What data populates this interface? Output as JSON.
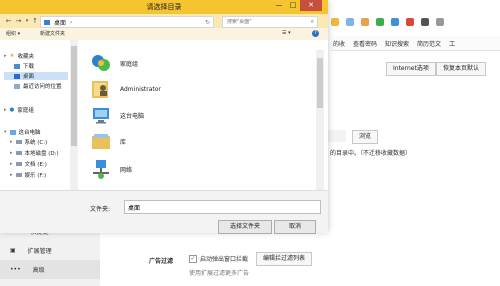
{
  "background": {
    "favorites_bar": [
      "的收",
      "查看密码",
      "知识搜索",
      "简历范文",
      "工"
    ],
    "internet_options_label": "Internet选项",
    "restore_default_label": "恢复本页默认",
    "browse_label": "浏览",
    "description": "的目录中。（不迁移收藏数据）",
    "sidebar": [
      "快捷键",
      "扩展管理",
      "高级"
    ],
    "ad_filter_label": "广告过滤",
    "ad_filter_checkbox_label": "启动弹出窗口拦截",
    "edit_filter_button": "编辑拦过滤列表",
    "ad_filter_hint": "使用扩展过滤更多广告",
    "colors": {
      "dialog_frame": "#f4c431",
      "close_button": "#c7503d",
      "selection": "#cce0f7"
    }
  },
  "dialog": {
    "title": "请选择目录",
    "window_controls": {
      "minimize": "—",
      "maximize": "□",
      "close": "✕"
    },
    "address": "桌面",
    "address_chevron": "›",
    "search_placeholder": "搜索\"桌面\"",
    "toolbar": {
      "organize": "组织 ▾",
      "new_folder": "新建文件夹",
      "view": "☰ ▾",
      "help": "?"
    },
    "nav": {
      "favorites": "收藏夹",
      "downloads": "下载",
      "desktop": "桌面",
      "recent": "最近访问的位置",
      "homegroup": "家庭组",
      "this_pc": "这台电脑",
      "drives": [
        "系统 (C:)",
        "本地磁盘 (D:)",
        "文档 (E:)",
        "娱乐 (F:)"
      ]
    },
    "content": [
      "家庭组",
      "Administrator",
      "这台电脑",
      "库",
      "网络"
    ],
    "folder_label": "文件夹:",
    "folder_value": "桌面",
    "select_button": "选择文件夹",
    "cancel_button": "取消"
  }
}
